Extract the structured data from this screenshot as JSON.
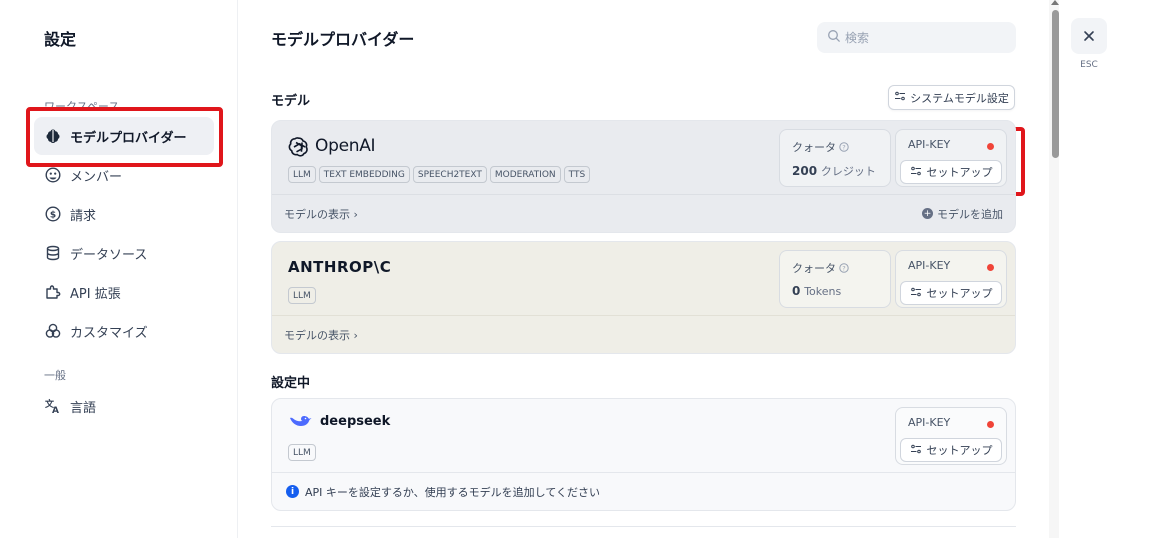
{
  "sidebar": {
    "title": "設定",
    "workspace_label": "ワークスペース",
    "general_label": "一般",
    "items": [
      {
        "label": "モデルプロバイダー",
        "icon": "brain-icon",
        "active": true
      },
      {
        "label": "メンバー",
        "icon": "members-icon"
      },
      {
        "label": "請求",
        "icon": "billing-icon"
      },
      {
        "label": "データソース",
        "icon": "database-icon"
      },
      {
        "label": "API 拡張",
        "icon": "puzzle-icon"
      },
      {
        "label": "カスタマイズ",
        "icon": "customize-icon"
      }
    ],
    "general_items": [
      {
        "label": "言語",
        "icon": "translate-icon"
      }
    ]
  },
  "main": {
    "title": "モデルプロバイダー",
    "search_placeholder": "検索",
    "models_section": "モデル",
    "system_model_button": "システムモデル設定",
    "configuring_section": "設定中",
    "providers": [
      {
        "name": "OpenAI",
        "tags": [
          "LLM",
          "TEXT EMBEDDING",
          "SPEECH2TEXT",
          "MODERATION",
          "TTS"
        ],
        "quota_label": "クォータ",
        "quota_value": "200",
        "quota_unit": "クレジット",
        "api_key_label": "API-KEY",
        "setup_label": "セットアップ",
        "show_models": "モデルの表示",
        "add_model": "モデルを追加"
      },
      {
        "name": "ANTHROP\\C",
        "tags": [
          "LLM"
        ],
        "quota_label": "クォータ",
        "quota_value": "0",
        "quota_unit": "Tokens",
        "api_key_label": "API-KEY",
        "setup_label": "セットアップ",
        "show_models": "モデルの表示"
      }
    ],
    "configuring": [
      {
        "name": "deepseek",
        "tags": [
          "LLM"
        ],
        "api_key_label": "API-KEY",
        "setup_label": "セットアップ",
        "info": "API キーを設定するか、使用するモデルを追加してください"
      }
    ]
  },
  "close": {
    "esc_label": "ESC"
  },
  "colors": {
    "status_dot": "#f04438",
    "highlight": "#e0161b",
    "info": "#155eef"
  }
}
